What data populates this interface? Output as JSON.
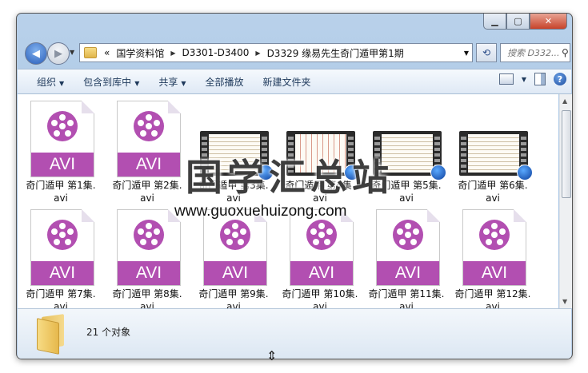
{
  "window": {
    "min_label": "▁",
    "max_label": "▢",
    "close_label": "✕"
  },
  "nav": {
    "back_icon": "back-arrow-icon",
    "forward_icon": "forward-arrow-icon",
    "breadcrumb_overflow": "«",
    "breadcrumbs": [
      "国学资料馆",
      "D3301-D3400",
      "D3329 缘易先生奇门遁甲第1期"
    ],
    "search_placeholder": "搜索 D332..."
  },
  "toolbar": {
    "organize": "组织",
    "include_in_library": "包含到库中",
    "share": "共享",
    "play_all": "全部播放",
    "new_folder": "新建文件夹"
  },
  "files": [
    {
      "name": "奇门遁甲 第1集.\navi",
      "kind": "avi"
    },
    {
      "name": "奇门遁甲 第2集.\navi",
      "kind": "avi"
    },
    {
      "name": "奇门遁甲 第3集.\navi",
      "kind": "thumb"
    },
    {
      "name": "奇门遁甲 第4集.\navi",
      "kind": "thumb"
    },
    {
      "name": "奇门遁甲 第5集.\navi",
      "kind": "thumb"
    },
    {
      "name": "奇门遁甲 第6集.\navi",
      "kind": "thumb"
    },
    {
      "name": "奇门遁甲 第7集.\navi",
      "kind": "avi"
    },
    {
      "name": "奇门遁甲 第8集.\navi",
      "kind": "avi"
    },
    {
      "name": "奇门遁甲 第9集.\navi",
      "kind": "avi"
    },
    {
      "name": "奇门遁甲 第10集.\navi",
      "kind": "avi"
    },
    {
      "name": "奇门遁甲 第11集.\navi",
      "kind": "avi"
    },
    {
      "name": "奇门遁甲 第12集.\navi",
      "kind": "avi"
    }
  ],
  "avi_label": "AVI",
  "watermark": {
    "title": "国学汇总站",
    "url": "www.guoxuehuizong.com"
  },
  "details": {
    "count": "21 个对象"
  },
  "colors": {
    "avi_purple": "#b24fb1",
    "window_frame": "#b9d1ea",
    "toolbar_text": "#1e395b"
  }
}
